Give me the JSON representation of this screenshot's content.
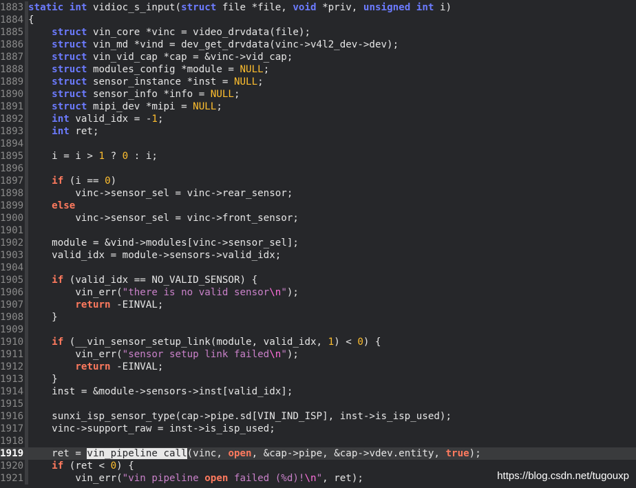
{
  "lines": [
    {
      "num": "1883",
      "tokens": [
        [
          "k",
          "static "
        ],
        [
          "t",
          "int "
        ],
        [
          "",
          "vidioc_s_input("
        ],
        [
          "k",
          "struct"
        ],
        [
          "",
          " file *file, "
        ],
        [
          "t",
          "void"
        ],
        [
          "",
          " *priv, "
        ],
        [
          "t",
          "unsigned int"
        ],
        [
          "",
          " i)"
        ]
      ]
    },
    {
      "num": "1884",
      "tokens": [
        [
          "",
          "{"
        ]
      ]
    },
    {
      "num": "1885",
      "tokens": [
        [
          "",
          "    "
        ],
        [
          "k",
          "struct"
        ],
        [
          "",
          " vin_core *vinc = video_drvdata(file);"
        ]
      ]
    },
    {
      "num": "1886",
      "tokens": [
        [
          "",
          "    "
        ],
        [
          "k",
          "struct"
        ],
        [
          "",
          " vin_md *vind = dev_get_drvdata(vinc->v4l2_dev->dev);"
        ]
      ]
    },
    {
      "num": "1887",
      "tokens": [
        [
          "",
          "    "
        ],
        [
          "k",
          "struct"
        ],
        [
          "",
          " vin_vid_cap *cap = &vinc->vid_cap;"
        ]
      ]
    },
    {
      "num": "1888",
      "tokens": [
        [
          "",
          "    "
        ],
        [
          "k",
          "struct"
        ],
        [
          "",
          " modules_config *module = "
        ],
        [
          "c",
          "NULL"
        ],
        [
          "",
          ";"
        ]
      ]
    },
    {
      "num": "1889",
      "tokens": [
        [
          "",
          "    "
        ],
        [
          "k",
          "struct"
        ],
        [
          "",
          " sensor_instance *inst = "
        ],
        [
          "c",
          "NULL"
        ],
        [
          "",
          ";"
        ]
      ]
    },
    {
      "num": "1890",
      "tokens": [
        [
          "",
          "    "
        ],
        [
          "k",
          "struct"
        ],
        [
          "",
          " sensor_info *info = "
        ],
        [
          "c",
          "NULL"
        ],
        [
          "",
          ";"
        ]
      ]
    },
    {
      "num": "1891",
      "tokens": [
        [
          "",
          "    "
        ],
        [
          "k",
          "struct"
        ],
        [
          "",
          " mipi_dev *mipi = "
        ],
        [
          "c",
          "NULL"
        ],
        [
          "",
          ";"
        ]
      ]
    },
    {
      "num": "1892",
      "tokens": [
        [
          "",
          "    "
        ],
        [
          "t",
          "int"
        ],
        [
          "",
          " valid_idx = -"
        ],
        [
          "n",
          "1"
        ],
        [
          "",
          ";"
        ]
      ]
    },
    {
      "num": "1893",
      "tokens": [
        [
          "",
          "    "
        ],
        [
          "t",
          "int"
        ],
        [
          "",
          " ret;"
        ]
      ]
    },
    {
      "num": "1894",
      "tokens": []
    },
    {
      "num": "1895",
      "tokens": [
        [
          "",
          "    i = i > "
        ],
        [
          "n",
          "1"
        ],
        [
          "",
          " ? "
        ],
        [
          "n",
          "0"
        ],
        [
          "",
          " : i;"
        ]
      ]
    },
    {
      "num": "1896",
      "tokens": []
    },
    {
      "num": "1897",
      "tokens": [
        [
          "",
          "    "
        ],
        [
          "r",
          "if"
        ],
        [
          "",
          " (i == "
        ],
        [
          "n",
          "0"
        ],
        [
          "",
          ")"
        ]
      ]
    },
    {
      "num": "1898",
      "tokens": [
        [
          "",
          "        vinc->sensor_sel = vinc->rear_sensor;"
        ]
      ]
    },
    {
      "num": "1899",
      "tokens": [
        [
          "",
          "    "
        ],
        [
          "r",
          "else"
        ]
      ]
    },
    {
      "num": "1900",
      "tokens": [
        [
          "",
          "        vinc->sensor_sel = vinc->front_sensor;"
        ]
      ]
    },
    {
      "num": "1901",
      "tokens": []
    },
    {
      "num": "1902",
      "tokens": [
        [
          "",
          "    module = &vind->modules[vinc->sensor_sel];"
        ]
      ]
    },
    {
      "num": "1903",
      "tokens": [
        [
          "",
          "    valid_idx = module->sensors->valid_idx;"
        ]
      ]
    },
    {
      "num": "1904",
      "tokens": []
    },
    {
      "num": "1905",
      "tokens": [
        [
          "",
          "    "
        ],
        [
          "r",
          "if"
        ],
        [
          "",
          " (valid_idx == NO_VALID_SENSOR) {"
        ]
      ]
    },
    {
      "num": "1906",
      "tokens": [
        [
          "",
          "        vin_err("
        ],
        [
          "s",
          "\"there is no valid sensor"
        ],
        [
          "e",
          "\\n"
        ],
        [
          "s",
          "\""
        ],
        [
          "",
          ");"
        ]
      ]
    },
    {
      "num": "1907",
      "tokens": [
        [
          "",
          "        "
        ],
        [
          "r",
          "return"
        ],
        [
          "",
          " -EINVAL;"
        ]
      ]
    },
    {
      "num": "1908",
      "tokens": [
        [
          "",
          "    }"
        ]
      ]
    },
    {
      "num": "1909",
      "tokens": []
    },
    {
      "num": "1910",
      "tokens": [
        [
          "",
          "    "
        ],
        [
          "r",
          "if"
        ],
        [
          "",
          " (__vin_sensor_setup_link(module, valid_idx, "
        ],
        [
          "n",
          "1"
        ],
        [
          "",
          ") < "
        ],
        [
          "n",
          "0"
        ],
        [
          "",
          ") {"
        ]
      ]
    },
    {
      "num": "1911",
      "tokens": [
        [
          "",
          "        vin_err("
        ],
        [
          "s",
          "\"sensor setup link failed"
        ],
        [
          "e",
          "\\n"
        ],
        [
          "s",
          "\""
        ],
        [
          "",
          ");"
        ]
      ]
    },
    {
      "num": "1912",
      "tokens": [
        [
          "",
          "        "
        ],
        [
          "r",
          "return"
        ],
        [
          "",
          " -EINVAL;"
        ]
      ]
    },
    {
      "num": "1913",
      "tokens": [
        [
          "",
          "    }"
        ]
      ]
    },
    {
      "num": "1914",
      "tokens": [
        [
          "",
          "    inst = &module->sensors->inst[valid_idx];"
        ]
      ]
    },
    {
      "num": "1915",
      "tokens": []
    },
    {
      "num": "1916",
      "tokens": [
        [
          "",
          "    sunxi_isp_sensor_type(cap->pipe.sd[VIN_IND_ISP], inst->is_isp_used);"
        ]
      ]
    },
    {
      "num": "1917",
      "tokens": [
        [
          "",
          "    vinc->support_raw = inst->is_isp_used;"
        ]
      ]
    },
    {
      "num": "1918",
      "tokens": []
    },
    {
      "num": "1919",
      "current": true,
      "tokens": [
        [
          "",
          "    ret = "
        ],
        [
          "sel",
          "vin_pipeline c"
        ],
        [
          "cur",
          "all"
        ],
        [
          "",
          "(vinc, "
        ],
        [
          "r",
          "open"
        ],
        [
          "",
          ", &cap->pipe, &cap->vdev.entity, "
        ],
        [
          "r",
          "true"
        ],
        [
          "",
          ");"
        ]
      ]
    },
    {
      "num": "1920",
      "tokens": [
        [
          "",
          "    "
        ],
        [
          "r",
          "if"
        ],
        [
          "",
          " (ret < "
        ],
        [
          "n",
          "0"
        ],
        [
          "",
          ") {"
        ]
      ]
    },
    {
      "num": "1921",
      "tokens": [
        [
          "",
          "        vin_err("
        ],
        [
          "s",
          "\"vin pipeline "
        ],
        [
          "r",
          "open"
        ],
        [
          "s",
          " failed (%d)!"
        ],
        [
          "e",
          "\\n"
        ],
        [
          "s",
          "\""
        ],
        [
          "",
          ", ret);"
        ]
      ]
    }
  ],
  "watermark": "https://blog.csdn.net/tugouxp"
}
